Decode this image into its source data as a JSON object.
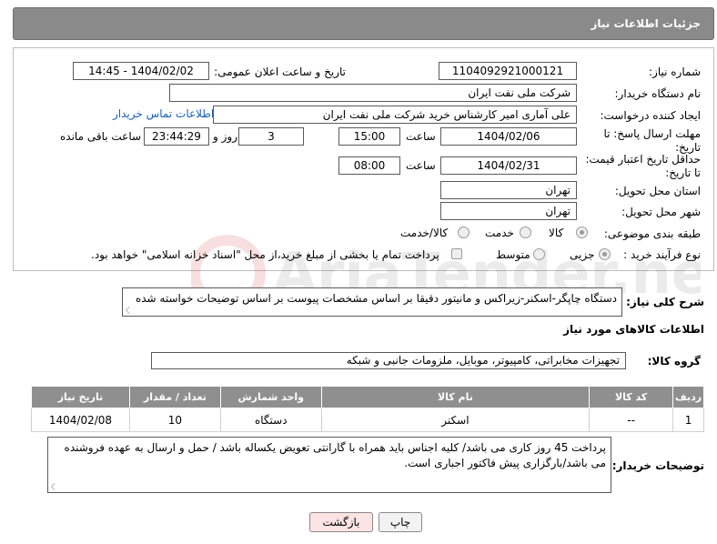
{
  "header": {
    "title": "جزئیات اطلاعات نیاز"
  },
  "form": {
    "need_number_label": "شماره نیاز:",
    "need_number": "1104092921000121",
    "announce_label": "تاریخ و ساعت اعلان عمومی:",
    "announce_value": "1404/02/02 - 14:45",
    "buyer_org_label": "نام دستگاه خریدار:",
    "buyer_org": "شرکت ملی نفت ایران",
    "creator_label": "ایجاد کننده درخواست:",
    "creator": "علی آماری امیر کارشناس خرید شرکت ملی نفت ایران",
    "contact_link": "اطلاعات تماس خریدار",
    "deadline_label": "مهلت ارسال پاسخ: تا تاریخ:",
    "deadline_date": "1404/02/06",
    "time_label": "ساعت",
    "deadline_time": "15:00",
    "days_value": "3",
    "days_label": "روز و",
    "remaining_time": "23:44:29",
    "remaining_label": "ساعت باقی مانده",
    "validity_label": "حداقل تاریخ اعتبار قیمت: تا تاریخ:",
    "validity_date": "1404/02/31",
    "validity_time_label": "ساعت",
    "validity_time": "08:00",
    "province_label": "استان محل تحویل:",
    "province": "تهران",
    "city_label": "شهر محل تحویل:",
    "city": "تهران",
    "category_label": "طبقه بندی موضوعی:",
    "category_options": [
      "کالا",
      "خدمت",
      "کالا/خدمت"
    ],
    "process_label": "نوع فرآیند خرید :",
    "process_options": [
      "جزیی",
      "متوسط"
    ],
    "payment_note": "پرداخت تمام یا بخشی از مبلغ خرید،از محل \"اسناد خزانه اسلامی\" خواهد بود."
  },
  "description": {
    "label": "شرح کلی نیاز:",
    "text": "دستگاه چاپگر-اسکنر-زیراکس و مانیتور دقیقا بر اساس مشخصات پیوست بر اساس توضیحات خواسته شده"
  },
  "goods_info": {
    "title": "اطلاعات کالاهای مورد نیاز",
    "group_label": "گروه کالا:",
    "group_value": "تجهیزات مخابراتی، کامپیوتر، موبایل، ملزومات جانبی و شبکه"
  },
  "table": {
    "headers": [
      "ردیف",
      "کد کالا",
      "نام کالا",
      "واحد شمارش",
      "تعداد / مقدار",
      "تاریخ نیاز"
    ],
    "rows": [
      [
        "1",
        "--",
        "اسکنر",
        "دستگاه",
        "10",
        "1404/02/08"
      ]
    ]
  },
  "buyer_notes": {
    "label": "توضیحات خریدار:",
    "text": "پرداخت 45 روز کاری می باشد/ کلیه اجناس باید همراه با گارانتی تعویض یکساله باشد / حمل و ارسال به عهده فروشنده می باشد/بارگزاری پیش فاکتور اجباری است."
  },
  "buttons": {
    "print": "چاپ",
    "back": "بازگشت"
  },
  "colors": {
    "header_bg": "#8a8a8a",
    "link": "#1a5fb4",
    "back_button_bg": "#fde3e3"
  },
  "watermark": {
    "text": "AriaTender.neT"
  }
}
